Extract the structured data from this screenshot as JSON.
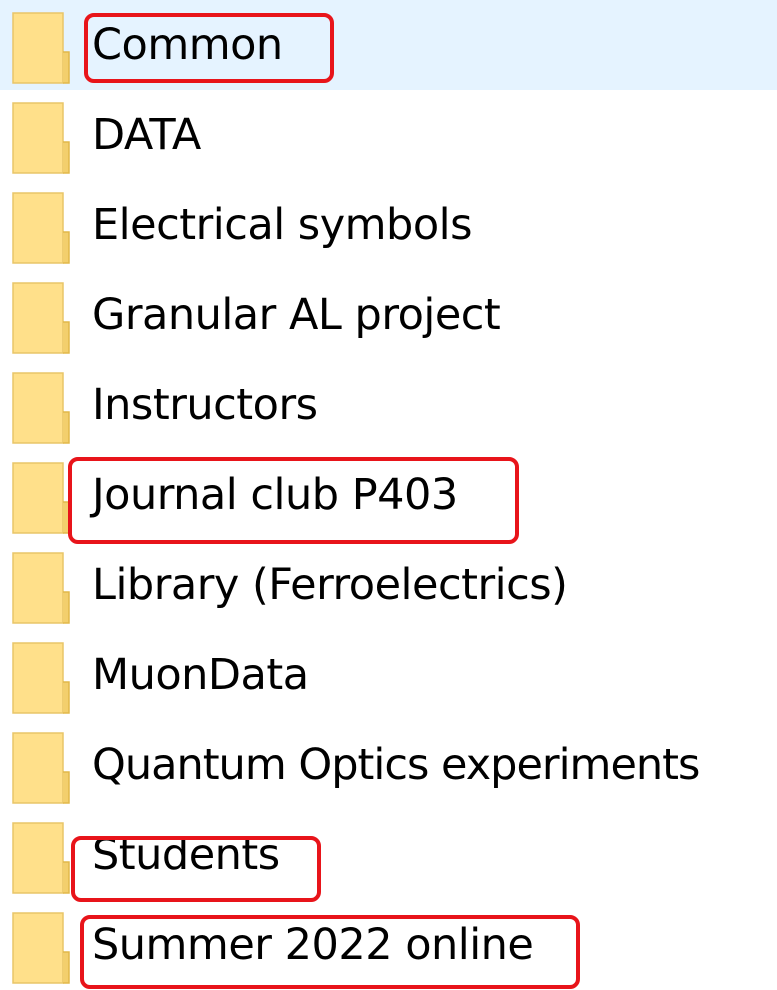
{
  "folders": [
    {
      "name": "Common",
      "selected": true,
      "highlighted": true
    },
    {
      "name": "DATA",
      "selected": false,
      "highlighted": false
    },
    {
      "name": "Electrical symbols",
      "selected": false,
      "highlighted": false
    },
    {
      "name": "Granular AL project",
      "selected": false,
      "highlighted": false
    },
    {
      "name": "Instructors",
      "selected": false,
      "highlighted": false
    },
    {
      "name": "Journal club P403",
      "selected": false,
      "highlighted": true
    },
    {
      "name": "Library (Ferroelectrics)",
      "selected": false,
      "highlighted": false
    },
    {
      "name": "MuonData",
      "selected": false,
      "highlighted": false
    },
    {
      "name": "Quantum Optics experiments",
      "selected": false,
      "highlighted": false
    },
    {
      "name": "Students",
      "selected": false,
      "highlighted": true
    },
    {
      "name": "Summer 2022 online",
      "selected": false,
      "highlighted": true
    }
  ],
  "icon": "folder-icon",
  "colors": {
    "selection_background": "#e5f3ff",
    "highlight_outline": "#e8141a",
    "folder_fill": "#ffe08a",
    "folder_edge": "#e2b84a"
  }
}
